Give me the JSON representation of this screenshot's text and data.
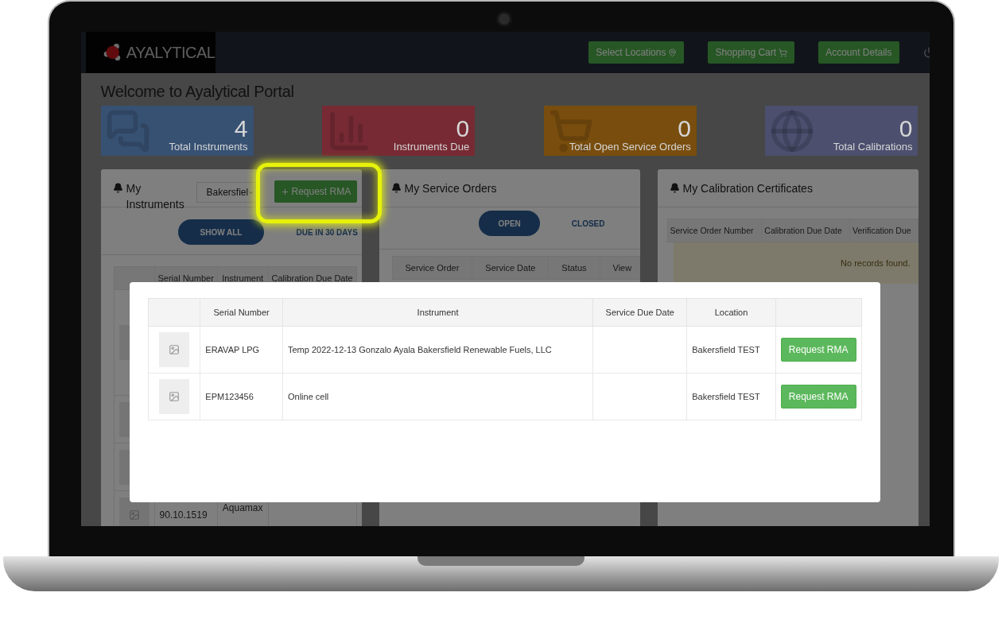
{
  "navbar": {
    "brand": "AYALYTICAL",
    "buttons": [
      {
        "label": "Select Locations",
        "kind": "pin"
      },
      {
        "label": "Shopping Cart",
        "kind": "cart"
      },
      {
        "label": "Account Details",
        "kind": "plain"
      }
    ]
  },
  "page_title": "Welcome to Ayalytical Portal",
  "stats": [
    {
      "value": "4",
      "label": "Total Instruments",
      "kind": "chat"
    },
    {
      "value": "0",
      "label": "Instruments Due",
      "kind": "chart"
    },
    {
      "value": "0",
      "label": "Total Open Service Orders",
      "kind": "cart"
    },
    {
      "value": "0",
      "label": "Total Calibrations",
      "kind": "globe"
    }
  ],
  "instruments_panel": {
    "title": "My Instruments",
    "location_select": {
      "value": "Bakersfiel"
    },
    "request_button": "Request RMA",
    "filters": [
      {
        "label": "SHOW ALL",
        "selected": true
      },
      {
        "label": "DUE IN 30 DAYS",
        "selected": false
      }
    ],
    "columns": [
      "Serial Number",
      "Instrument",
      "Calibration Due Date"
    ],
    "rows": [
      {
        "thumbnail": true
      },
      {
        "thumbnail": true
      },
      {
        "thumbnail": true
      },
      {
        "thumbnail": true,
        "serial_number": "90.10.1519",
        "instrument": "Aquamax"
      }
    ]
  },
  "service_orders_panel": {
    "title": "My Service Orders",
    "tabs": [
      {
        "label": "OPEN",
        "selected": true
      },
      {
        "label": "CLOSED",
        "selected": false
      }
    ],
    "columns": [
      "Service Order",
      "Service Date",
      "Status",
      "View"
    ]
  },
  "certificates_panel": {
    "title": "My Calibration Certificates",
    "columns": [
      "Service Order Number",
      "Calibration Due Date",
      "Verification Due"
    ],
    "empty_message": "No records found."
  },
  "modal": {
    "columns": [
      "Serial Number",
      "Instrument",
      "Service Due Date",
      "Location"
    ],
    "rows": [
      {
        "serial_number": "ERAVAP LPG",
        "instrument": "Temp 2022-12-13 Gonzalo Ayala Bakersfield Renewable Fuels, LLC",
        "location": "Bakersfield TEST",
        "action": "Request RMA"
      },
      {
        "serial_number": "EPM123456",
        "instrument": "Online cell",
        "location": "Bakersfield TEST",
        "action": "Request RMA"
      }
    ]
  }
}
